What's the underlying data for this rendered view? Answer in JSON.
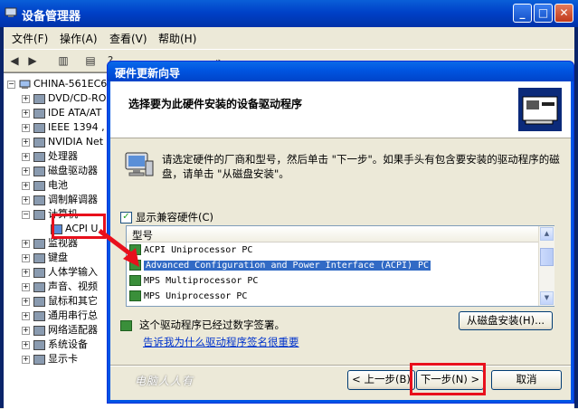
{
  "devmgr": {
    "title": "设备管理器",
    "menu": [
      "文件(F)",
      "操作(A)",
      "查看(V)",
      "帮助(H)"
    ],
    "tree": {
      "root": "CHINA-561EC6",
      "items": [
        {
          "label": "DVD/CD-RO",
          "icon": "cdrom-icon"
        },
        {
          "label": "IDE ATA/AT",
          "icon": "ide-icon"
        },
        {
          "label": "IEEE 1394 ,",
          "icon": "firewire-icon"
        },
        {
          "label": "NVIDIA Net",
          "icon": "network-icon"
        },
        {
          "label": "处理器",
          "icon": "cpu-icon"
        },
        {
          "label": "磁盘驱动器",
          "icon": "disk-icon"
        },
        {
          "label": "电池",
          "icon": "battery-icon"
        },
        {
          "label": "调制解调器",
          "icon": "modem-icon"
        },
        {
          "label": "计算机",
          "icon": "computer-icon",
          "expanded": true
        },
        {
          "label": "ACPI U",
          "icon": "acpi-icon",
          "child": true
        },
        {
          "label": "监视器",
          "icon": "monitor-icon"
        },
        {
          "label": "键盘",
          "icon": "keyboard-icon"
        },
        {
          "label": "人体学输入",
          "icon": "hid-icon"
        },
        {
          "label": "声音、视频",
          "icon": "sound-icon"
        },
        {
          "label": "鼠标和其它",
          "icon": "mouse-icon"
        },
        {
          "label": "通用串行总",
          "icon": "usb-icon"
        },
        {
          "label": "网络适配器",
          "icon": "network-adapter-icon"
        },
        {
          "label": "系统设备",
          "icon": "system-icon"
        },
        {
          "label": "显示卡",
          "icon": "display-icon"
        }
      ]
    }
  },
  "wizard": {
    "title": "硬件更新向导",
    "header": "选择要为此硬件安装的设备驱动程序",
    "description": "请选定硬件的厂商和型号，然后单击 \"下一步\"。如果手头有包含要安装的驱动程序的磁盘，请单击 \"从磁盘安装\"。",
    "show_compatible_label": "显示兼容硬件(C)",
    "show_compatible_checked": true,
    "list_header": "型号",
    "models": [
      {
        "label": "ACPI Uniprocessor PC",
        "selected": false
      },
      {
        "label": "Advanced Configuration and Power Interface (ACPI) PC",
        "selected": true
      },
      {
        "label": "MPS Multiprocessor PC",
        "selected": false
      },
      {
        "label": "MPS Uniprocessor PC",
        "selected": false
      }
    ],
    "signed_text": "这个驱动程序已经过数字签署。",
    "signed_link": "告诉我为什么驱动程序签名很重要",
    "have_disk": "从磁盘安装(H)...",
    "back": "< 上一步(B)",
    "next": "下一步(N) >",
    "cancel": "取消",
    "watermark": "电脑人人有"
  },
  "colors": {
    "title_bar": "#0054e3",
    "selection": "#316ac5",
    "highlight": "#e8101c"
  }
}
